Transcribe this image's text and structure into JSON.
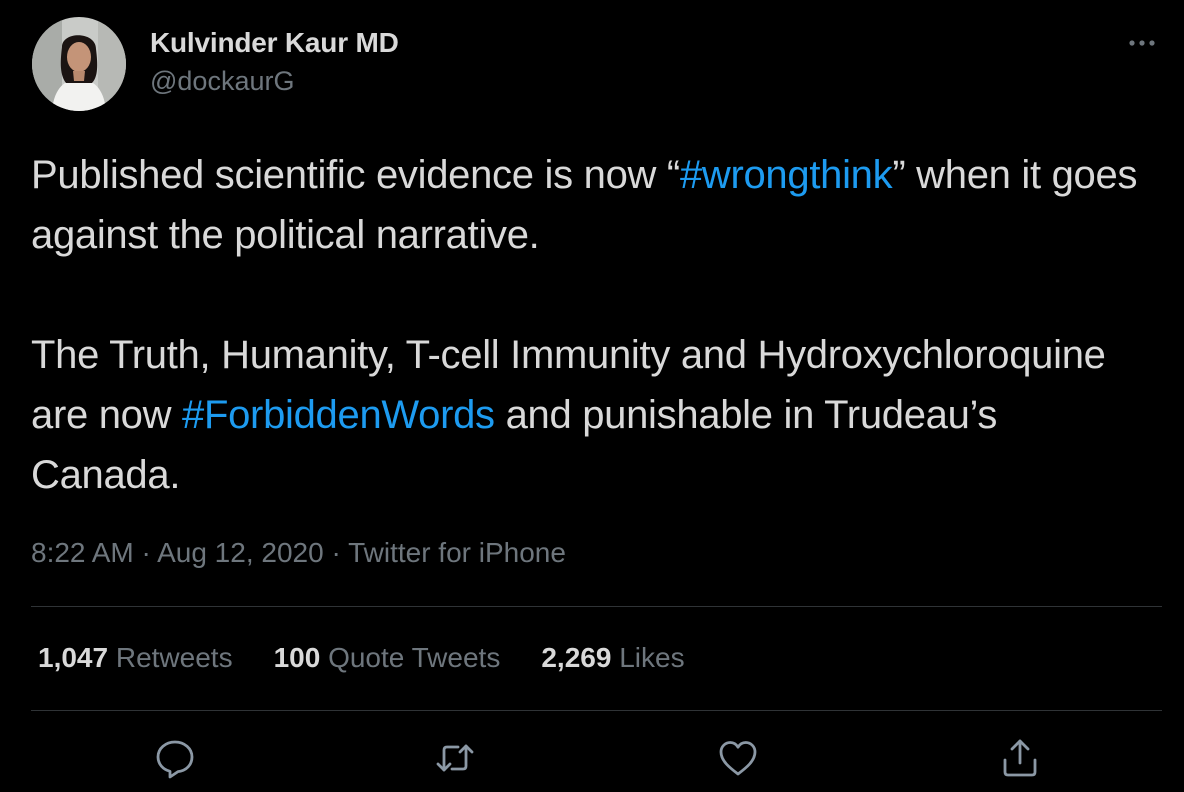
{
  "author": {
    "name": "Kulvinder Kaur MD",
    "handle": "@dockaurG"
  },
  "tweet": {
    "paragraph1": {
      "before": "Published scientific evidence is now “",
      "hashtag": "#wrongthink",
      "after": "” when it goes against the political narrative."
    },
    "paragraph2": {
      "before": "The Truth, Humanity, T-cell Immunity and Hydroxychloroquine are now ",
      "hashtag": "#ForbiddenWords",
      "after": " and punishable in Trudeau’s Canada."
    }
  },
  "meta": {
    "time": "8:22 AM",
    "separator": " · ",
    "date": "Aug 12, 2020",
    "source": "Twitter for iPhone"
  },
  "stats": {
    "retweets": {
      "count": "1,047",
      "label": "Retweets"
    },
    "quote_tweets": {
      "count": "100",
      "label": "Quote Tweets"
    },
    "likes": {
      "count": "2,269",
      "label": "Likes"
    }
  },
  "icons": {
    "more": "more-dots-icon",
    "reply": "reply-bubble-icon",
    "retweet": "retweet-arrows-icon",
    "like": "heart-icon",
    "share": "share-upload-icon"
  },
  "colors": {
    "background": "#000000",
    "text": "#d9d9d9",
    "secondary_text": "#6e767d",
    "hashtag": "#1d9bf0",
    "divider": "#2f3336"
  }
}
